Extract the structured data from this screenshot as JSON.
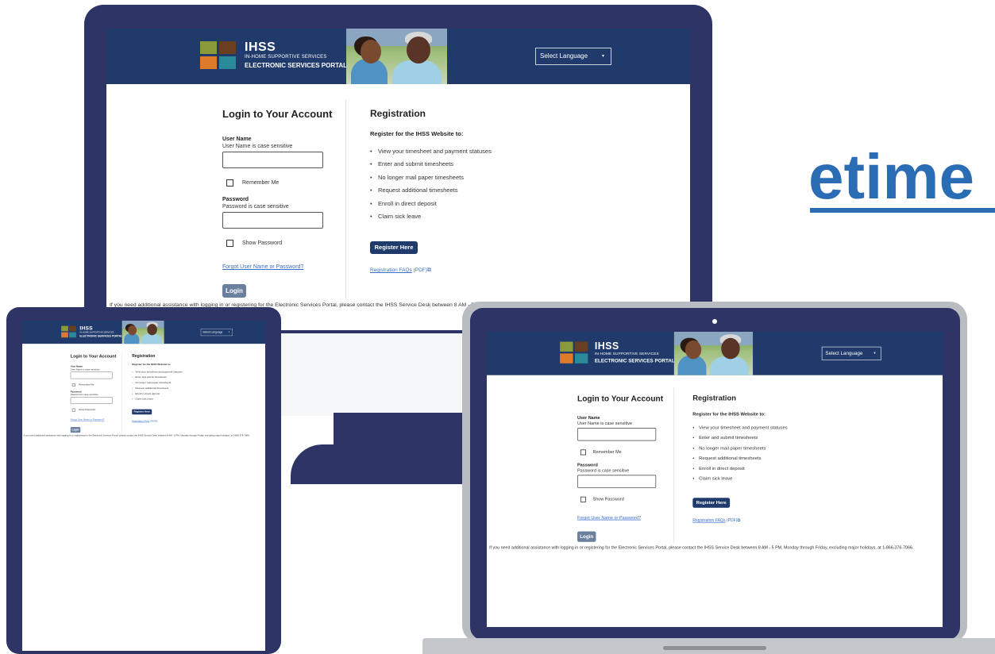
{
  "brand_word": "etime",
  "colors": {
    "device_frame": "#2e3566",
    "header_bg": "#1f3a6b",
    "link": "#3b6ec7",
    "brand_word": "#2a6db5",
    "login_button": "#6b7f9e",
    "register_button": "#1f3a6b"
  },
  "portal": {
    "logo": {
      "name": "IHSS",
      "subtitle": "IN-HOME SUPPORTIVE SERVICES",
      "portal_name": "ELECTRONIC SERVICES PORTAL"
    },
    "language_select": {
      "label": "Select Language",
      "caret": "▾"
    },
    "login": {
      "title": "Login to Your Account",
      "username_label": "User Name",
      "username_hint": "User Name is case sensitive",
      "remember_me": "Remember Me",
      "password_label": "Password",
      "password_hint": "Password is case sensitive",
      "show_password": "Show Password",
      "forgot": "Forgot User Name or Password?",
      "login_button": "Login"
    },
    "registration": {
      "title": "Registration",
      "subtitle": "Register for the IHSS Website to:",
      "bullet": "•",
      "items": [
        "View your timesheet and payment statuses",
        "Enter and submit timesheets",
        "No longer mail paper timesheets",
        "Request additional timesheets",
        "Enroll in direct deposit",
        "Claim sick leave"
      ],
      "register_button": "Register Here",
      "faq_link": "Registration FAQs",
      "faq_suffix": "(PDF)",
      "external_icon": "⧉"
    },
    "footer_note": "If you need additional assistance with logging in or registering for the Electronic Services Portal, please contact the IHSS Service Desk between 8 AM - 5 PM, Monday through Friday, excluding major holidays, at 1-866-376-7066."
  }
}
